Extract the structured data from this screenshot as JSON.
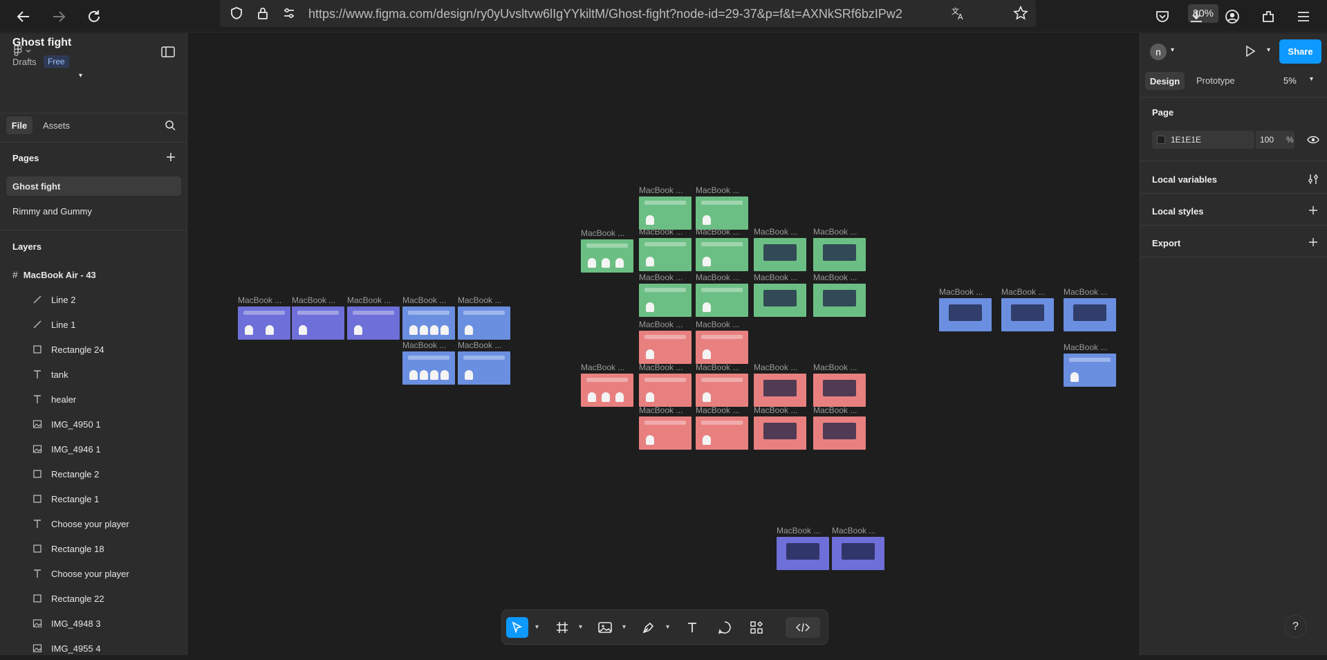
{
  "browser": {
    "url": "https://www.figma.com/design/ry0yUvsltvw6lIgYYkiltM/Ghost-fight?node-id=29-37&p=f&t=AXNkSRf6bzIPw2",
    "zoom": "80%",
    "icons": [
      "back-icon",
      "forward-icon",
      "reload-icon",
      "shield-icon",
      "lock-icon",
      "permissions-icon",
      "translate-icon",
      "star-icon",
      "pocket-icon",
      "download-icon",
      "account-icon",
      "extensions-icon",
      "menu-icon"
    ]
  },
  "left_panel": {
    "file_title": "Ghost fight",
    "drafts": "Drafts",
    "plan_badge": "Free",
    "tabs": {
      "file": "File",
      "assets": "Assets"
    },
    "pages_title": "Pages",
    "pages": [
      {
        "label": "Ghost fight",
        "active": true
      },
      {
        "label": "Rimmy and Gummy",
        "active": false
      }
    ],
    "layers_title": "Layers",
    "root_layer": "MacBook Air - 43",
    "layers": [
      {
        "label": "Line 2",
        "icon": "line-icon"
      },
      {
        "label": "Line 1",
        "icon": "line-icon"
      },
      {
        "label": "Rectangle 24",
        "icon": "rectangle-icon"
      },
      {
        "label": "tank",
        "icon": "text-icon"
      },
      {
        "label": "healer",
        "icon": "text-icon"
      },
      {
        "label": "IMG_4950 1",
        "icon": "image-icon"
      },
      {
        "label": "IMG_4946 1",
        "icon": "image-icon"
      },
      {
        "label": "Rectangle 2",
        "icon": "rectangle-icon"
      },
      {
        "label": "Rectangle 1",
        "icon": "rectangle-icon"
      },
      {
        "label": "Choose your player",
        "icon": "text-icon"
      },
      {
        "label": "Rectangle 18",
        "icon": "rectangle-icon"
      },
      {
        "label": "Choose your player",
        "icon": "text-icon"
      },
      {
        "label": "Rectangle 22",
        "icon": "rectangle-icon"
      },
      {
        "label": "IMG_4948 3",
        "icon": "image-icon"
      },
      {
        "label": "IMG_4955 4",
        "icon": "image-icon"
      }
    ]
  },
  "right_panel": {
    "avatar_initial": "n",
    "share_label": "Share",
    "tabs": {
      "design": "Design",
      "prototype": "Prototype"
    },
    "zoom": "5%",
    "page_section": "Page",
    "page_color": "1E1E1E",
    "page_opacity": "100",
    "opacity_unit": "%",
    "local_variables": "Local variables",
    "local_styles": "Local styles",
    "export": "Export"
  },
  "canvas": {
    "frame_label": "MacBook ...",
    "colors": {
      "purple": "#6e6fd8",
      "blue": "#6b8fe0",
      "green": "#6cbf84",
      "red": "#e88080",
      "dark": "#2f2f6b"
    }
  },
  "help_label": "?"
}
